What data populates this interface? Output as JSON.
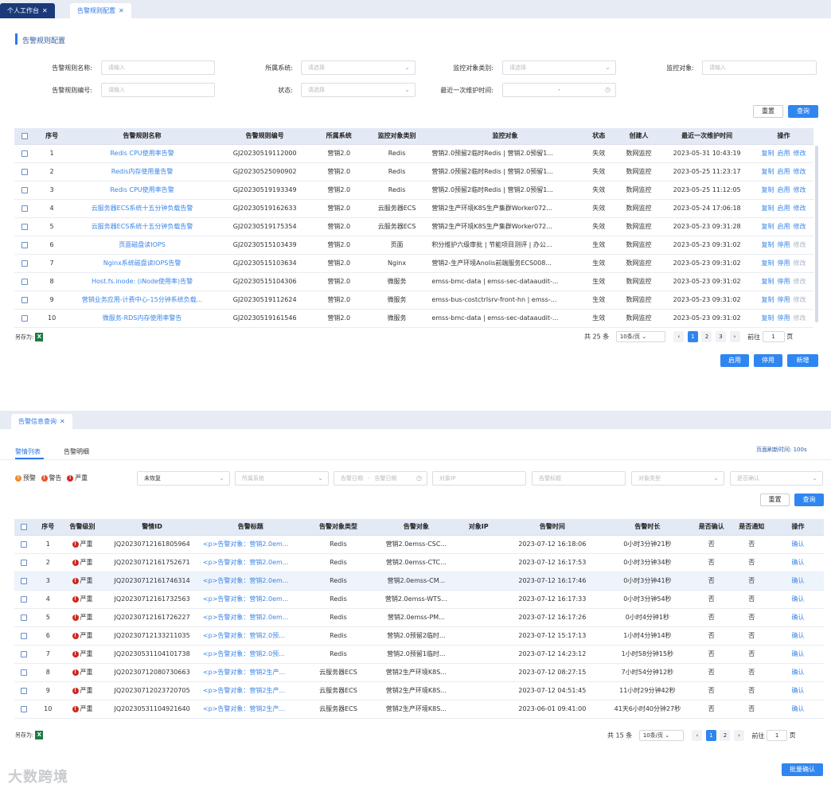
{
  "top": {
    "tabs": [
      {
        "label": "个人工作台"
      },
      {
        "label": "告警规则配置"
      }
    ],
    "section_title": "告警规则配置",
    "filters": {
      "rule_name": {
        "label": "告警规则名称:",
        "placeholder": "请输入"
      },
      "system": {
        "label": "所属系统:",
        "placeholder": "请选择"
      },
      "object_type": {
        "label": "监控对象类别:",
        "placeholder": "请选择"
      },
      "monitor_object": {
        "label": "监控对象:",
        "placeholder": "请输入"
      },
      "rule_code": {
        "label": "告警规则编号:",
        "placeholder": "请输入"
      },
      "status": {
        "label": "状态:",
        "placeholder": "请选择"
      },
      "last_maint": {
        "label": "最近一次维护时间:",
        "value": "-"
      }
    },
    "buttons": {
      "reset": "重置",
      "query": "查询",
      "enable": "启用",
      "disable": "停用",
      "add": "新增"
    },
    "columns": [
      "序号",
      "告警规则名称",
      "告警规则编号",
      "所属系统",
      "监控对象类别",
      "监控对象",
      "状态",
      "创建人",
      "最近一次维护时间",
      "操作"
    ],
    "rows": [
      {
        "no": "1",
        "name": "Redis CPU使用率告警",
        "code": "GJ20230519112000",
        "system": "营销2.0",
        "type": "Redis",
        "object": "营销2.0预留2临时Redis | 营销2.0预留1...",
        "status": "失效",
        "creator": "数网监控",
        "time": "2023-05-31 10:43:19",
        "ops": [
          "复制",
          "启用",
          "修改"
        ]
      },
      {
        "no": "2",
        "name": "Redis内存使用量告警",
        "code": "GJ20230525090902",
        "system": "营销2.0",
        "type": "Redis",
        "object": "营销2.0预留2临时Redis | 营销2.0预留1...",
        "status": "失效",
        "creator": "数网监控",
        "time": "2023-05-25 11:23:17",
        "ops": [
          "复制",
          "启用",
          "修改"
        ]
      },
      {
        "no": "3",
        "name": "Redis CPU使用率告警",
        "code": "GJ20230519193349",
        "system": "营销2.0",
        "type": "Redis",
        "object": "营销2.0预留2临时Redis | 营销2.0预留1...",
        "status": "失效",
        "creator": "数网监控",
        "time": "2023-05-25 11:12:05",
        "ops": [
          "复制",
          "启用",
          "修改"
        ]
      },
      {
        "no": "4",
        "name": "云服务器ECS系统十五分钟负载告警",
        "code": "GJ20230519162633",
        "system": "营销2.0",
        "type": "云服务器ECS",
        "object": "营销2生产环境K8S生产集群Worker072...",
        "status": "失效",
        "creator": "数网监控",
        "time": "2023-05-24 17:06:18",
        "ops": [
          "复制",
          "启用",
          "修改"
        ]
      },
      {
        "no": "5",
        "name": "云服务器ECS系统十五分钟负载告警",
        "code": "GJ20230519175354",
        "system": "营销2.0",
        "type": "云服务器ECS",
        "object": "营销2生产环境K8S生产集群Worker072...",
        "status": "失效",
        "creator": "数网监控",
        "time": "2023-05-23 09:31:28",
        "ops": [
          "复制",
          "启用",
          "修改"
        ]
      },
      {
        "no": "6",
        "name": "页面磁盘读IOPS",
        "code": "GJ20230515103439",
        "system": "营销2.0",
        "type": "页面",
        "object": "积分维护六级审批 | 节能项目测评 | 办公...",
        "status": "生效",
        "creator": "数网监控",
        "time": "2023-05-23 09:31:02",
        "ops": [
          "复制",
          "停用",
          "修改"
        ]
      },
      {
        "no": "7",
        "name": "Nginx系统磁盘读IOPS告警",
        "code": "GJ20230515103634",
        "system": "营销2.0",
        "type": "Nginx",
        "object": "营销2-生产环境Anolis前端服务ECS008...",
        "status": "生效",
        "creator": "数网监控",
        "time": "2023-05-23 09:31:02",
        "ops": [
          "复制",
          "停用",
          "修改"
        ]
      },
      {
        "no": "8",
        "name": "Host.fs.inode: (iNode使用率)告警",
        "code": "GJ20230515104306",
        "system": "营销2.0",
        "type": "微服务",
        "object": "emss-bmc-data | emss-sec-dataaudit-...",
        "status": "生效",
        "creator": "数网监控",
        "time": "2023-05-23 09:31:02",
        "ops": [
          "复制",
          "停用",
          "修改"
        ]
      },
      {
        "no": "9",
        "name": "营销业务应用-计费中心-15分钟系统负载...",
        "code": "GJ20230519112624",
        "system": "营销2.0",
        "type": "微服务",
        "object": "emss-bus-costctrlsrv-front-hn | emss-...",
        "status": "生效",
        "creator": "数网监控",
        "time": "2023-05-23 09:31:02",
        "ops": [
          "复制",
          "停用",
          "修改"
        ]
      },
      {
        "no": "10",
        "name": "微服务-RDS内存使用率警告",
        "code": "GJ20230519161546",
        "system": "营销2.0",
        "type": "微服务",
        "object": "emss-bmc-data | emss-sec-dataaudit-...",
        "status": "生效",
        "creator": "数网监控",
        "time": "2023-05-23 09:31:02",
        "ops": [
          "复制",
          "停用",
          "修改"
        ]
      }
    ],
    "saveas": "另存为:",
    "pager": {
      "total": "共 25 条",
      "page_size": "10条/页",
      "pages": [
        "1",
        "2",
        "3"
      ],
      "goto": "前往",
      "goto_value": "1",
      "page_unit": "页"
    }
  },
  "bottom": {
    "tabs": [
      {
        "label": "告警信息查询"
      }
    ],
    "subtabs": [
      "警情列表",
      "告警明细"
    ],
    "refresh": "页面刷新时间: 100s",
    "legend": [
      {
        "label": "预警",
        "color": "#f08a24"
      },
      {
        "label": "警告",
        "color": "#e8542c"
      },
      {
        "label": "严重",
        "color": "#d0281f"
      }
    ],
    "filters": {
      "recover": "未恢复",
      "system": "所属系统",
      "date_start": "告警日期",
      "date_sep": "-",
      "date_end": "告警日期",
      "ip": "对象IP",
      "title": "告警标题",
      "obj_type": "对象类型",
      "confirmed": "是否确认"
    },
    "buttons": {
      "reset": "重置",
      "query": "查询",
      "batch": "批量确认"
    },
    "columns": [
      "序号",
      "告警级别",
      "警情ID",
      "告警标题",
      "告警对象类型",
      "告警对象",
      "对象IP",
      "告警时间",
      "告警时长",
      "是否确认",
      "是否通知",
      "操作"
    ],
    "rows": [
      {
        "no": "1",
        "level": "严重",
        "id": "JQ20230712161805964",
        "title": "<p>告警对象：营销2.0em...",
        "otype": "Redis",
        "obj": "营销2.0emss-CSC...",
        "ip": "",
        "time": "2023-07-12 16:18:06",
        "dur": "0小时3分钟21秒",
        "confirmed": "否",
        "notified": "否",
        "op": "确认"
      },
      {
        "no": "2",
        "level": "严重",
        "id": "JQ20230712161752671",
        "title": "<p>告警对象：营销2.0em...",
        "otype": "Redis",
        "obj": "营销2.0emss-CTC...",
        "ip": "",
        "time": "2023-07-12 16:17:53",
        "dur": "0小时3分钟34秒",
        "confirmed": "否",
        "notified": "否",
        "op": "确认"
      },
      {
        "no": "3",
        "level": "严重",
        "id": "JQ20230712161746314",
        "title": "<p>告警对象：营销2.0em...",
        "otype": "Redis",
        "obj": "营销2.0emss-CM...",
        "ip": "",
        "time": "2023-07-12 16:17:46",
        "dur": "0小时3分钟41秒",
        "confirmed": "否",
        "notified": "否",
        "op": "确认"
      },
      {
        "no": "4",
        "level": "严重",
        "id": "JQ20230712161732563",
        "title": "<p>告警对象：营销2.0em...",
        "otype": "Redis",
        "obj": "营销2.0emss-WTS...",
        "ip": "",
        "time": "2023-07-12 16:17:33",
        "dur": "0小时3分钟54秒",
        "confirmed": "否",
        "notified": "否",
        "op": "确认"
      },
      {
        "no": "5",
        "level": "严重",
        "id": "JQ20230712161726227",
        "title": "<p>告警对象：营销2.0em...",
        "otype": "Redis",
        "obj": "营销2.0emss-PM...",
        "ip": "",
        "time": "2023-07-12 16:17:26",
        "dur": "0小时4分钟1秒",
        "confirmed": "否",
        "notified": "否",
        "op": "确认"
      },
      {
        "no": "6",
        "level": "严重",
        "id": "JQ20230712133211035",
        "title": "<p>告警对象：营销2.0预...",
        "otype": "Redis",
        "obj": "营销2.0预留2临时...",
        "ip": "",
        "time": "2023-07-12 15:17:13",
        "dur": "1小时4分钟14秒",
        "confirmed": "否",
        "notified": "否",
        "op": "确认"
      },
      {
        "no": "7",
        "level": "严重",
        "id": "JQ20230531104101738",
        "title": "<p>告警对象：营销2.0预...",
        "otype": "Redis",
        "obj": "营销2.0预留1临时...",
        "ip": "",
        "time": "2023-07-12 14:23:12",
        "dur": "1小时58分钟15秒",
        "confirmed": "否",
        "notified": "否",
        "op": "确认"
      },
      {
        "no": "8",
        "level": "严重",
        "id": "JQ20230712080730663",
        "title": "<p>告警对象：营销2生产...",
        "otype": "云服务器ECS",
        "obj": "营销2生产环境K8S...",
        "ip": "",
        "time": "2023-07-12 08:27:15",
        "dur": "7小时54分钟12秒",
        "confirmed": "否",
        "notified": "否",
        "op": "确认"
      },
      {
        "no": "9",
        "level": "严重",
        "id": "JQ20230712023720705",
        "title": "<p>告警对象：营销2生产...",
        "otype": "云服务器ECS",
        "obj": "营销2生产环境K8S...",
        "ip": "",
        "time": "2023-07-12 04:51:45",
        "dur": "11小时29分钟42秒",
        "confirmed": "否",
        "notified": "否",
        "op": "确认"
      },
      {
        "no": "10",
        "level": "严重",
        "id": "JQ20230531104921640",
        "title": "<p>告警对象：营销2生产...",
        "otype": "云服务器ECS",
        "obj": "营销2生产环境K8S...",
        "ip": "",
        "time": "2023-06-01 09:41:00",
        "dur": "41天6小时40分钟27秒",
        "confirmed": "否",
        "notified": "否",
        "op": "确认"
      }
    ],
    "saveas": "另存为:",
    "pager": {
      "total": "共 15 条",
      "page_size": "10条/页",
      "pages": [
        "1",
        "2"
      ],
      "goto": "前往",
      "goto_value": "1",
      "page_unit": "页"
    }
  },
  "watermark": "大数跨境"
}
